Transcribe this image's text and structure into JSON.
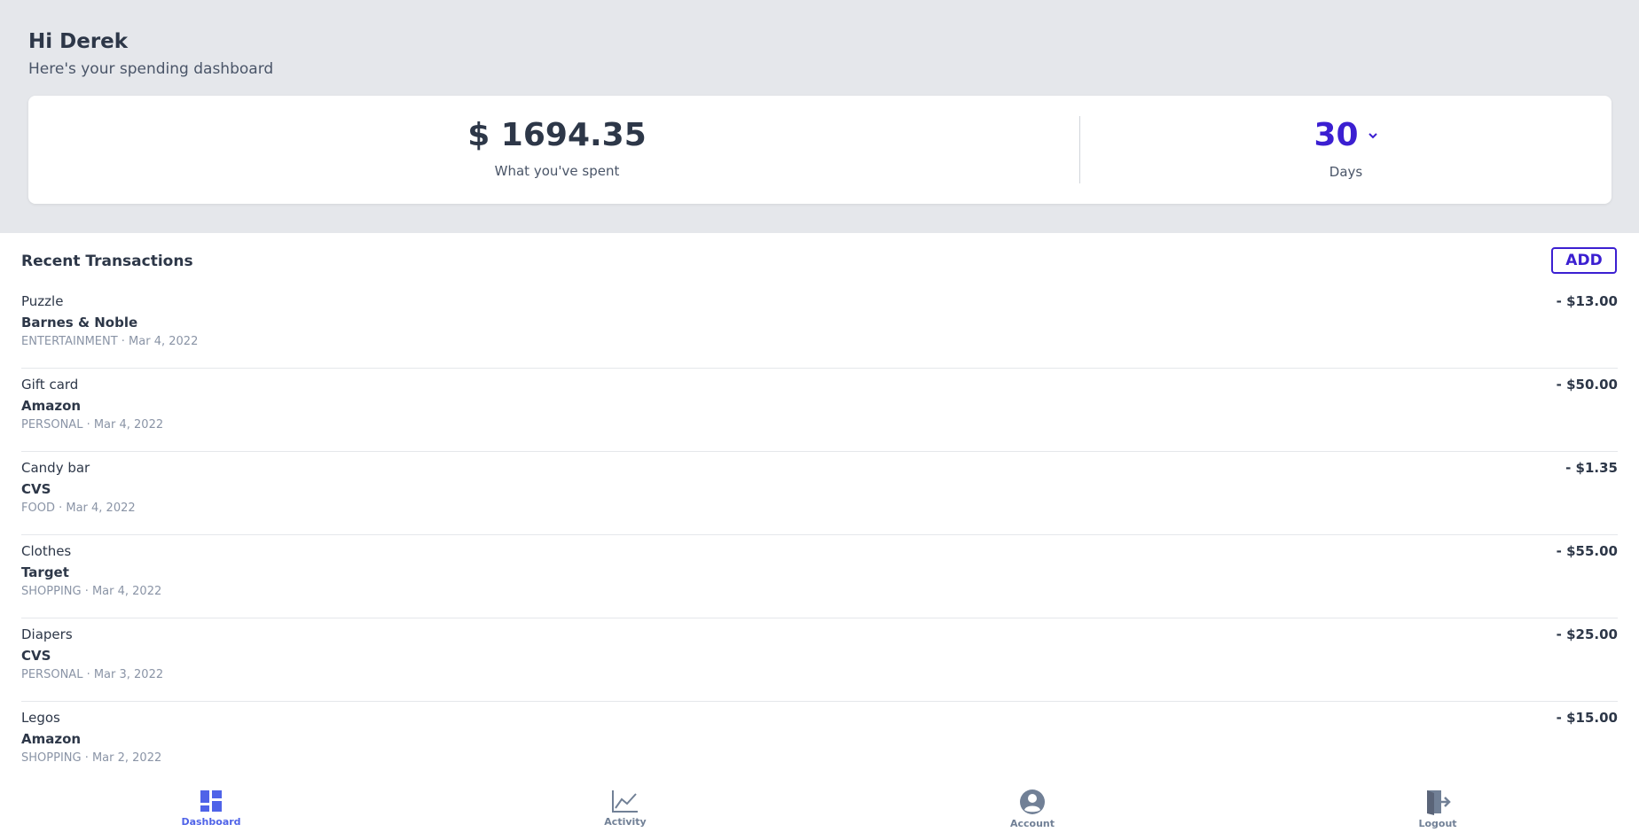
{
  "header": {
    "greeting": "Hi Derek",
    "subtitle": "Here's your spending dashboard"
  },
  "summary": {
    "spent_amount": "$ 1694.35",
    "spent_label": "What you've spent",
    "days_value": "30",
    "days_label": "Days"
  },
  "transactions": {
    "title": "Recent Transactions",
    "add_label": "ADD",
    "items": [
      {
        "description": "Puzzle",
        "merchant": "Barnes & Noble",
        "meta": "ENTERTAINMENT · Mar 4, 2022",
        "amount": "- $13.00"
      },
      {
        "description": "Gift card",
        "merchant": "Amazon",
        "meta": "PERSONAL · Mar 4, 2022",
        "amount": "- $50.00"
      },
      {
        "description": "Candy bar",
        "merchant": "CVS",
        "meta": "FOOD · Mar 4, 2022",
        "amount": "- $1.35"
      },
      {
        "description": "Clothes",
        "merchant": "Target",
        "meta": "SHOPPING · Mar 4, 2022",
        "amount": "- $55.00"
      },
      {
        "description": "Diapers",
        "merchant": "CVS",
        "meta": "PERSONAL · Mar 3, 2022",
        "amount": "- $25.00"
      },
      {
        "description": "Legos",
        "merchant": "Amazon",
        "meta": "SHOPPING · Mar 2, 2022",
        "amount": "- $15.00"
      }
    ]
  },
  "nav": {
    "items": [
      {
        "label": "Dashboard",
        "icon": "dashboard-icon",
        "active": true
      },
      {
        "label": "Activity",
        "icon": "chart-line-icon",
        "active": false
      },
      {
        "label": "Account",
        "icon": "user-circle-icon",
        "active": false
      },
      {
        "label": "Logout",
        "icon": "logout-icon",
        "active": false
      }
    ]
  },
  "colors": {
    "accent": "#3b1fd1",
    "nav_active": "#4f63e8",
    "header_bg": "#e5e7eb",
    "text": "#2d3748"
  }
}
